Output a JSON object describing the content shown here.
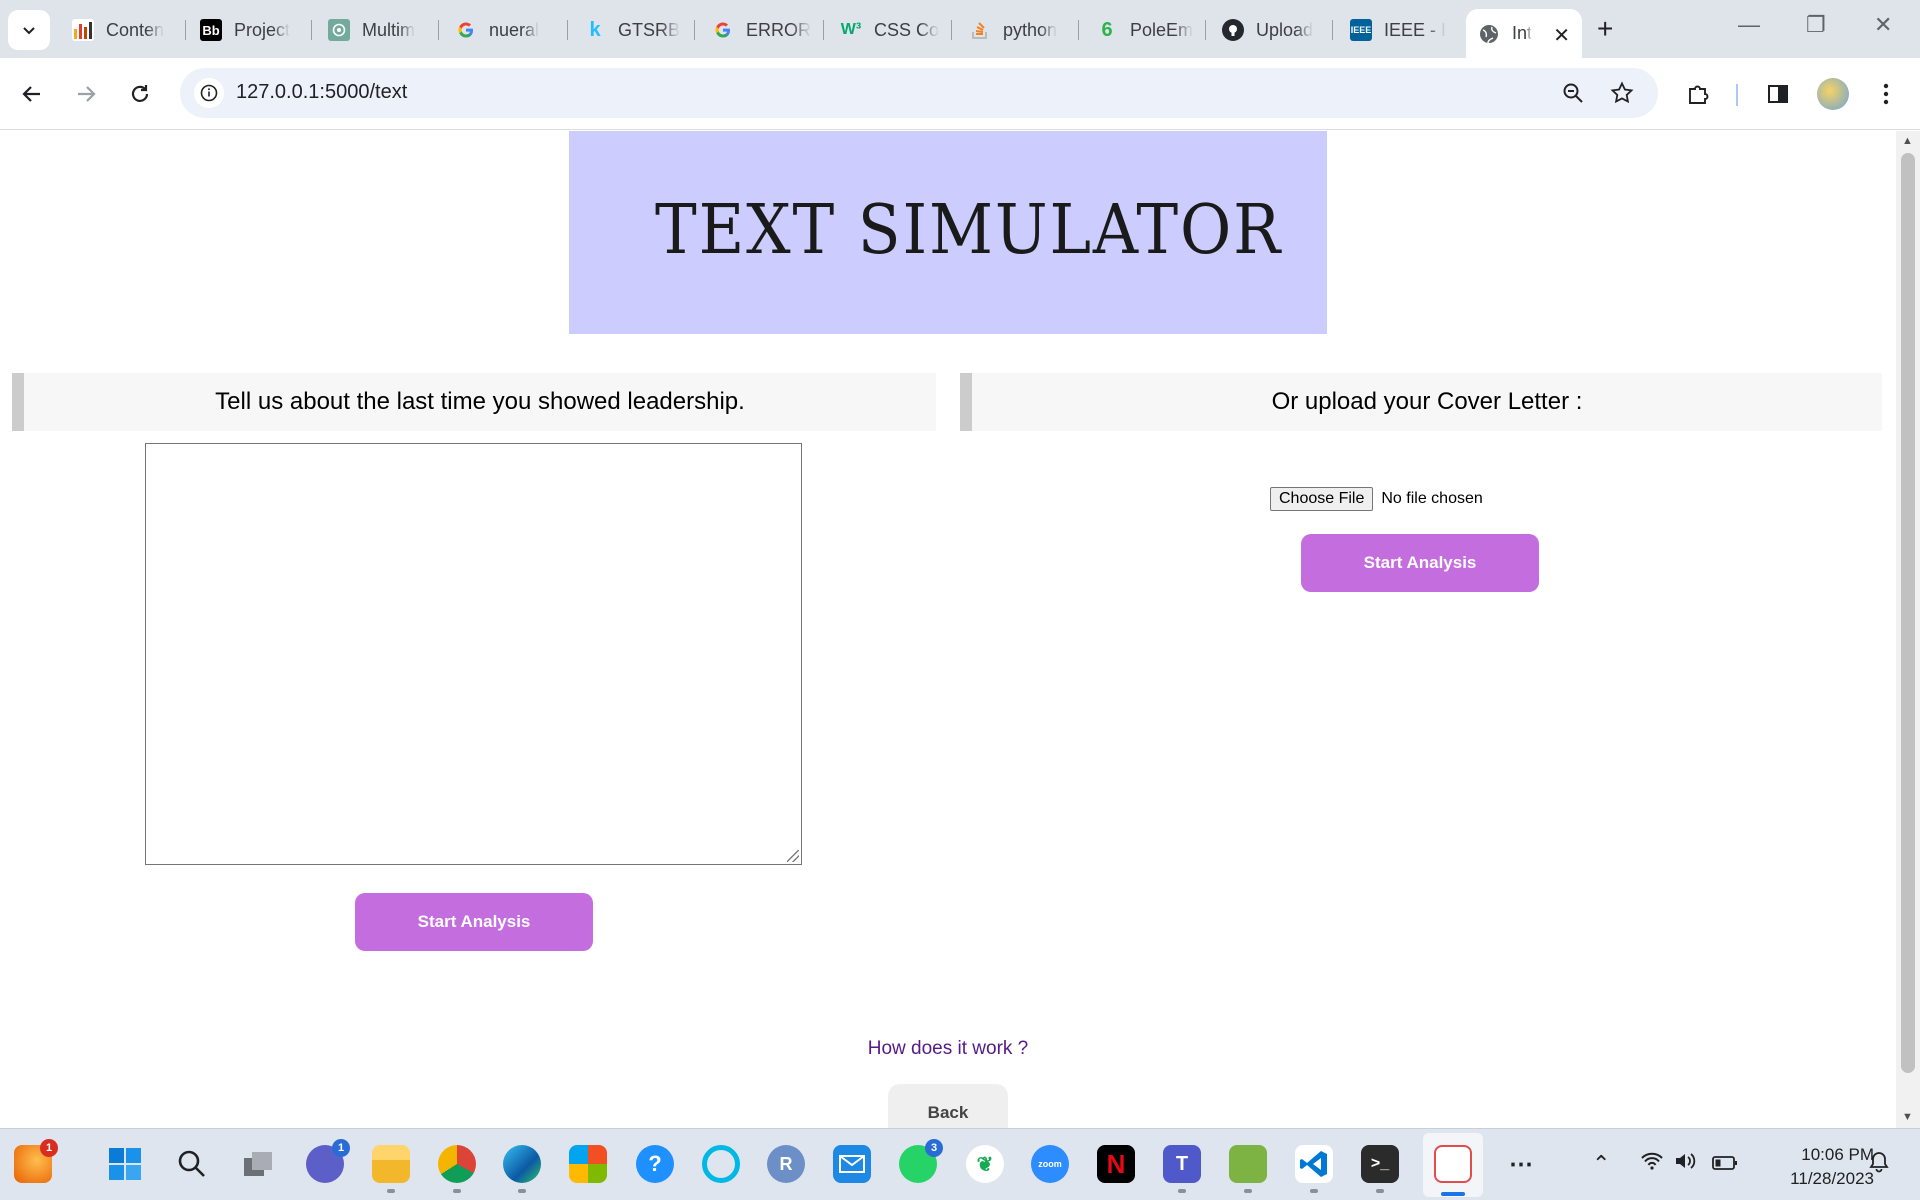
{
  "browser": {
    "tabs": [
      {
        "title": "Conten",
        "icon": "chart-favicon-icon",
        "color": "#b84b00"
      },
      {
        "title": "Project",
        "icon": "blackboard-favicon-icon",
        "color": "#000000"
      },
      {
        "title": "Multim",
        "icon": "chatgpt-favicon-icon",
        "color": "#74aa9c"
      },
      {
        "title": "nueral",
        "icon": "google-favicon-icon",
        "color": "#4285f4"
      },
      {
        "title": "GTSRB",
        "icon": "kaggle-favicon-icon",
        "color": "#20beff"
      },
      {
        "title": "ERROR",
        "icon": "google-favicon-icon",
        "color": "#4285f4"
      },
      {
        "title": "CSS Co",
        "icon": "w3schools-favicon-icon",
        "color": "#04aa6d"
      },
      {
        "title": "python",
        "icon": "stackoverflow-favicon-icon",
        "color": "#f48024"
      },
      {
        "title": "PoleEm",
        "icon": "poleemploi-favicon-icon",
        "color": "#2eb34a"
      },
      {
        "title": "Upload",
        "icon": "github-favicon-icon",
        "color": "#24292f"
      },
      {
        "title": "IEEE - I",
        "icon": "ieee-favicon-icon",
        "color": "#00629b"
      }
    ],
    "active_tab": {
      "title": "Int",
      "icon": "globe-favicon-icon"
    },
    "url": "127.0.0.1:5000/text"
  },
  "page": {
    "banner_title": "TEXT SIMULATOR",
    "left_prompt": "Tell us about the last time you showed leadership.",
    "right_prompt": "Or upload your Cover Letter :",
    "textarea_value": "",
    "file_button": "Choose File",
    "file_status": "No file chosen",
    "analysis_button_left": "Start Analysis",
    "analysis_button_right": "Start Analysis",
    "how_link": "How does it work ?",
    "back_button": "Back",
    "accent_color": "#c36ddf",
    "banner_color": "#ccccff"
  },
  "taskbar": {
    "badges": {
      "firefox": "1",
      "meet": "1",
      "whatsapp": "3"
    },
    "time": "10:06 PM",
    "date": "11/28/2023"
  }
}
